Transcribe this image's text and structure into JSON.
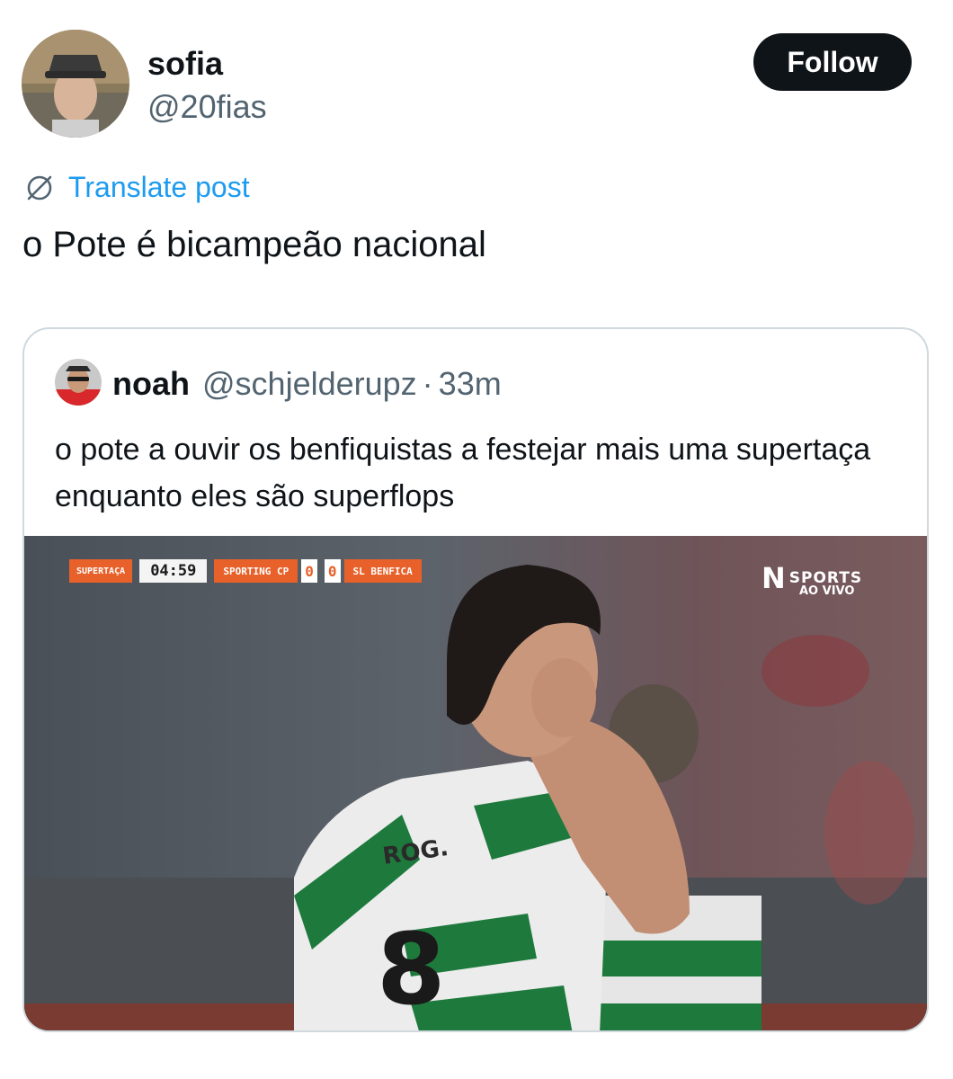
{
  "author": {
    "name": "sofia",
    "handle": "@20fias"
  },
  "follow_label": "Follow",
  "translate_label": "Translate post",
  "post_text": "o Pote é bicampeão nacional",
  "quoted": {
    "name": "noah",
    "handle": "@schjelderupz",
    "separator": "·",
    "time": "33m",
    "text": "o pote a ouvir os benfiquistas a festejar mais uma supertaça enquanto eles são superflops",
    "overlay": {
      "competition": "SUPERTAÇA",
      "clock": "04:59",
      "home_team": "SPORTING CP",
      "home_score": "0",
      "away_score": "0",
      "away_team": "SL BENFICA",
      "broadcaster_mark": "N",
      "broadcaster": "SPORTS",
      "broadcaster_sub": "AO VIVO"
    }
  },
  "colors": {
    "accent": "#1d9bf0",
    "text": "#0f1419",
    "muted": "#536471",
    "border": "#cfd9de",
    "scoreboard": "#e8612a",
    "kit_green": "#1e7a3c"
  },
  "icons": {
    "translate": "globe-slash-icon"
  }
}
